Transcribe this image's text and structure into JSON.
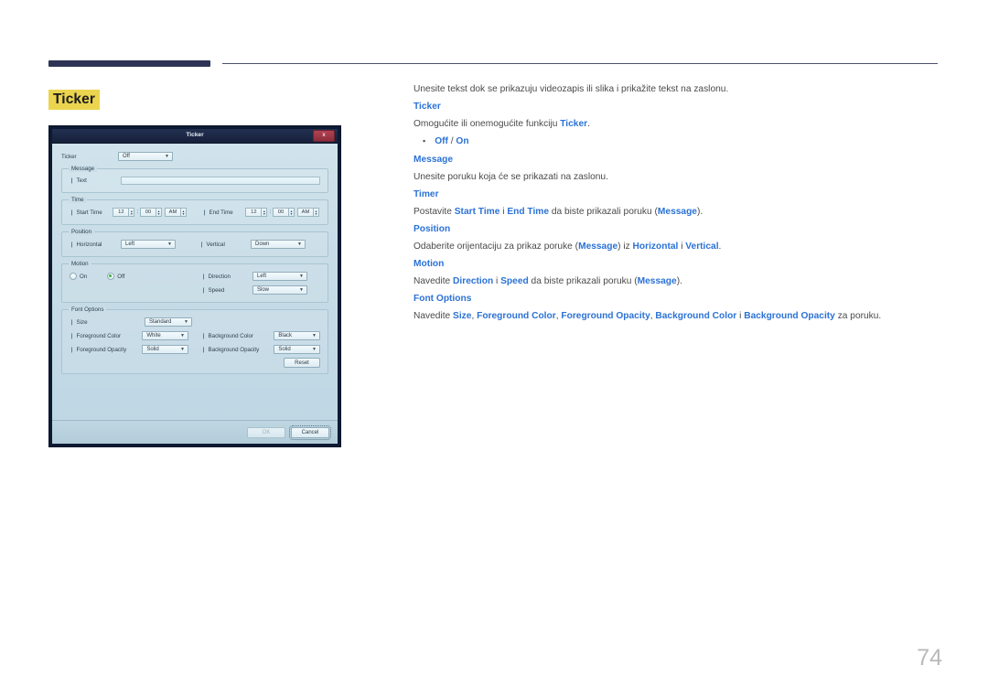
{
  "page": {
    "number": "74",
    "heading": "Ticker"
  },
  "dialog": {
    "title": "Ticker",
    "close_label": "x",
    "ticker_label": "Ticker",
    "ticker_value": "Off",
    "message": {
      "legend": "Message",
      "text_label": "Text",
      "text_value": ""
    },
    "time": {
      "legend": "Time",
      "start_label": "Start Time",
      "start_hour": "12",
      "start_minute": "00",
      "start_meridiem": "AM",
      "end_label": "End Time",
      "end_hour": "12",
      "end_minute": "00",
      "end_meridiem": "AM"
    },
    "position": {
      "legend": "Position",
      "horizontal_label": "Horizontal",
      "horizontal_value": "Left",
      "vertical_label": "Vertical",
      "vertical_value": "Down"
    },
    "motion": {
      "legend": "Motion",
      "on_label": "On",
      "off_label": "Off",
      "selected": "Off",
      "direction_label": "Direction",
      "direction_value": "Left",
      "speed_label": "Speed",
      "speed_value": "Slow"
    },
    "font_options": {
      "legend": "Font Options",
      "size_label": "Size",
      "size_value": "Standard",
      "foreground_color_label": "Foreground Color",
      "foreground_color_value": "White",
      "background_color_label": "Background Color",
      "background_color_value": "Black",
      "foreground_opacity_label": "Foreground Opacity",
      "foreground_opacity_value": "Solid",
      "background_opacity_label": "Background Opacity",
      "background_opacity_value": "Solid",
      "reset_label": "Reset"
    },
    "footer": {
      "ok_label": "OK",
      "cancel_label": "Cancel"
    }
  },
  "content": {
    "intro": "Unesite tekst dok se prikazuju videozapis ili slika i prikažite tekst na zaslonu.",
    "ticker_head": "Ticker",
    "ticker_desc_pre": "Omogućite ili onemogućite funkciju ",
    "ticker_desc_bold": "Ticker",
    "ticker_desc_post": ".",
    "bullet_off": "Off",
    "bullet_sep": " / ",
    "bullet_on": "On",
    "message_head": "Message",
    "message_desc": "Unesite poruku koja će se prikazati na zaslonu.",
    "timer_head": "Timer",
    "timer_pre": "Postavite ",
    "timer_b1": "Start Time",
    "timer_mid": " i ",
    "timer_b2": "End Time",
    "timer_mid2": " da biste prikazali poruku (",
    "timer_b3": "Message",
    "timer_post": ").",
    "position_head": "Position",
    "position_pre": "Odaberite orijentaciju za prikaz poruke (",
    "position_b1": "Message",
    "position_mid": ") iz ",
    "position_b2": "Horizontal",
    "position_mid2": " i ",
    "position_b3": "Vertical",
    "position_post": ".",
    "motion_head": "Motion",
    "motion_pre": "Navedite ",
    "motion_b1": "Direction",
    "motion_mid": " i ",
    "motion_b2": "Speed",
    "motion_mid2": " da biste prikazali poruku (",
    "motion_b3": "Message",
    "motion_post": ").",
    "font_head": "Font Options",
    "font_pre": "Navedite ",
    "font_b1": "Size",
    "font_s1": ", ",
    "font_b2": "Foreground Color",
    "font_s2": ", ",
    "font_b3": "Foreground Opacity",
    "font_s3": ", ",
    "font_b4": "Background Color",
    "font_s4": " i ",
    "font_b5": "Background Opacity",
    "font_post": " za poruku."
  },
  "colors": {
    "accent_blue": "#2b72d6",
    "highlight_yellow": "#ebd44e",
    "header_navy": "#2e3356",
    "dialog_blue": "#c7dce7"
  }
}
